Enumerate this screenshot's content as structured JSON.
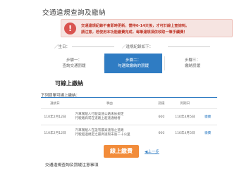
{
  "page": {
    "title": "交通違規查詢及繳納"
  },
  "alert": {
    "icon": "!",
    "line1": "交通違規紀錄不會即時更新，需待6-14天後，才可於線上查詢到。",
    "line2": "請注意，若使用本功能繳費完成，每筆違規須依收取一筆手續費！"
  },
  "filters": {
    "label1": "／生日：",
    "label2": "／違規紀錄如下："
  },
  "steps": [
    {
      "line1": "步驟一：",
      "line2": "查詢交通罰鍰"
    },
    {
      "line1": "步驟二：",
      "line2": "勾選欲繳納的罰鍰"
    },
    {
      "line1": "步驟三：",
      "line2": "繳納罰鍰"
    }
  ],
  "section": {
    "title": "可線上繳納"
  },
  "list": {
    "title": "下列罰單可線上繳納：",
    "headers": [
      "違規日",
      "",
      "事由",
      "",
      "罰鍰",
      "到期日",
      ""
    ],
    "rows": [
      {
        "date": "110年2月12日",
        "desc1": "汽車駕駛人行駛高速公路未依規定",
        "desc2": "行駛路肩或在道路上超速違規者",
        "amount": "600",
        "due": "110年4月5日",
        "action": "繳費"
      },
      {
        "date": "110年2月12日",
        "desc1": "汽車駕駛人在設有最高速限之道路",
        "desc2": "行駛超過規定之最高速限未逾二十公里",
        "amount": "600",
        "due": "110年4月5日",
        "action": "繳費"
      }
    ]
  },
  "buttons": {
    "submit": "線上繳費",
    "prev": "◀上一步"
  },
  "footer": {
    "note": "交通違規查詢及罰緩注意事項"
  }
}
